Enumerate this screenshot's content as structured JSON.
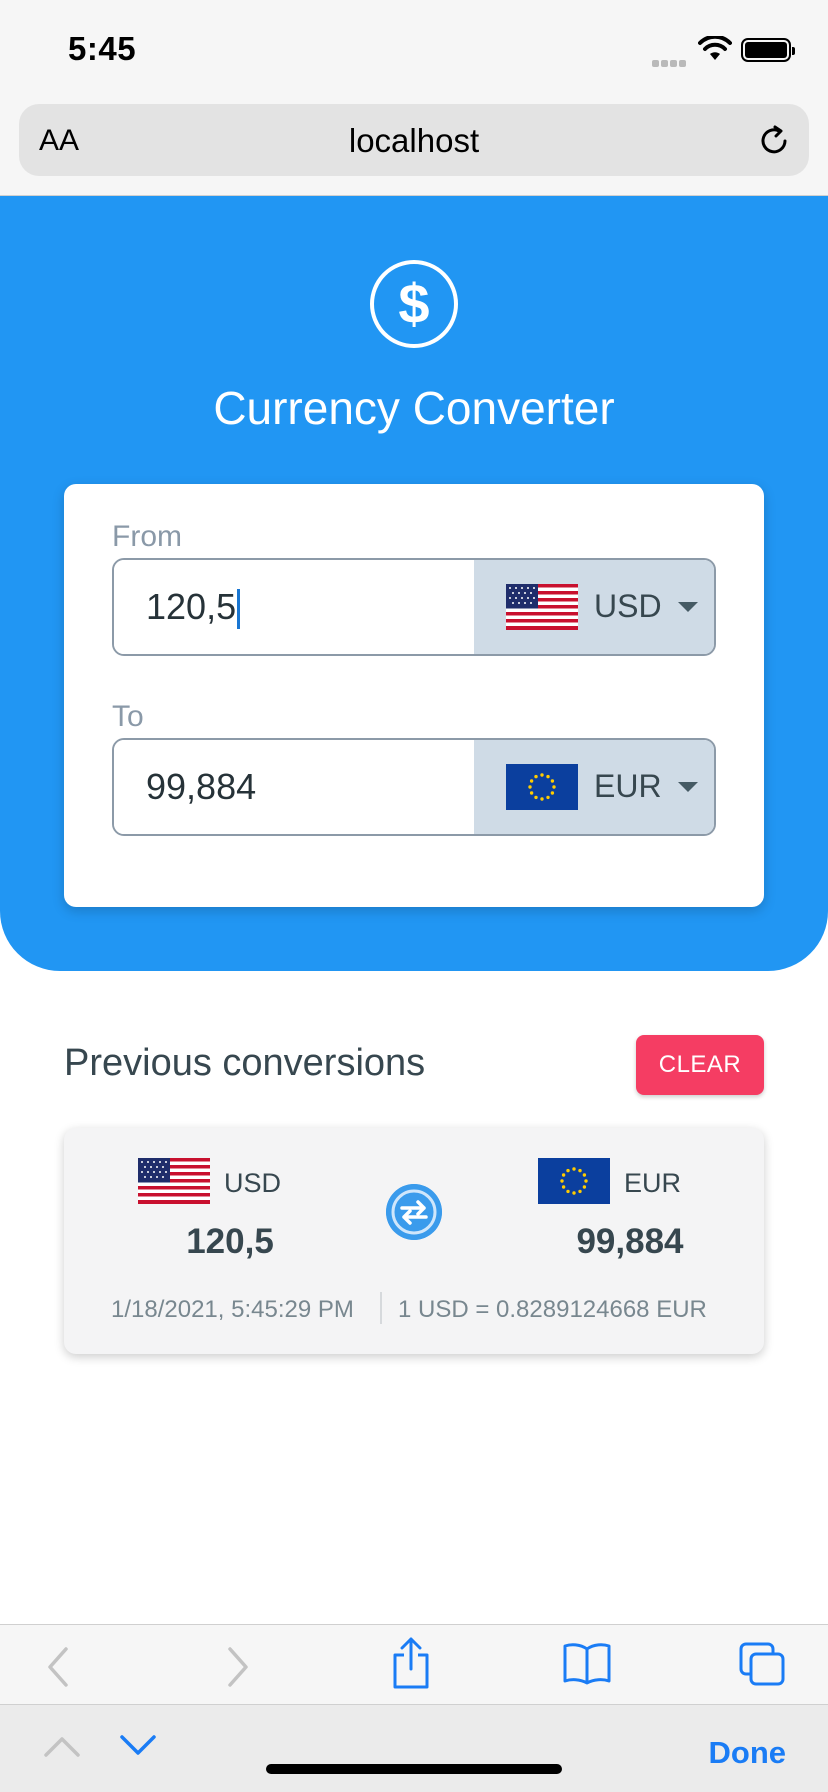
{
  "status_bar": {
    "time": "5:45"
  },
  "browser": {
    "text_size_label": "AA",
    "url": "localhost"
  },
  "app": {
    "title": "Currency Converter"
  },
  "converter": {
    "from_label": "From",
    "from_amount": "120,5",
    "from_currency": "USD",
    "to_label": "To",
    "to_amount": "99,884",
    "to_currency": "EUR"
  },
  "history": {
    "title": "Previous conversions",
    "clear_label": "CLEAR",
    "items": [
      {
        "from_currency": "USD",
        "from_amount": "120,5",
        "to_currency": "EUR",
        "to_amount": "99,884",
        "timestamp": "1/18/2021, 5:45:29 PM",
        "rate": "1 USD = 0.8289124668 EUR"
      }
    ]
  },
  "keyboard_accessory": {
    "done_label": "Done"
  },
  "colors": {
    "primary": "#2196f3",
    "danger": "#f53d63",
    "link": "#1a7cf5"
  }
}
